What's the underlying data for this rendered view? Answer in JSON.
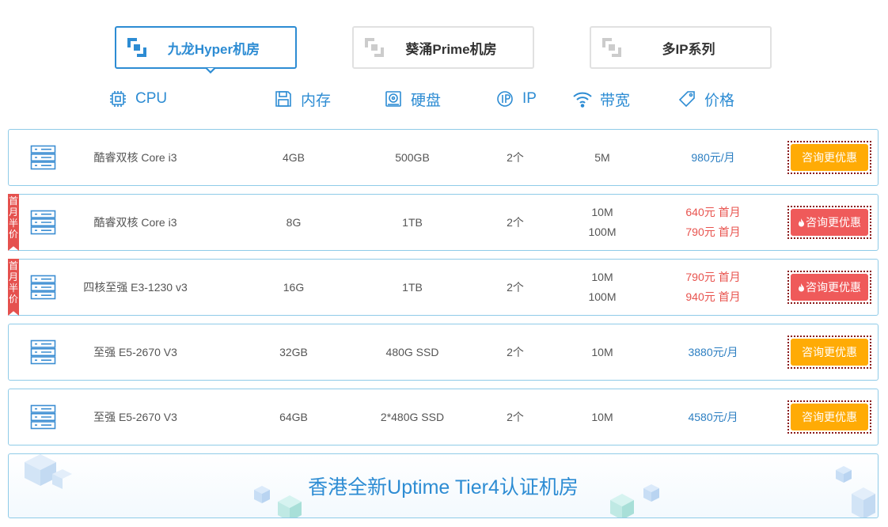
{
  "tabs": [
    {
      "label": "九龙Hyper机房",
      "active": true
    },
    {
      "label": "葵涌Prime机房",
      "active": false
    },
    {
      "label": "多IP系列",
      "active": false
    }
  ],
  "header": {
    "cpu": "CPU",
    "ram": "内存",
    "disk": "硬盘",
    "ip": "IP",
    "bandwidth": "带宽",
    "price": "价格"
  },
  "rows": [
    {
      "cpu": "酷睿双核 Core i3",
      "ram": "4GB",
      "disk": "500GB",
      "ip": "2个",
      "bw1": "5M",
      "bw2": "",
      "price1": "980元/月",
      "price2": "",
      "ribbon": "",
      "button": "咨询更优惠"
    },
    {
      "cpu": "酷睿双核 Core i3",
      "ram": "8G",
      "disk": "1TB",
      "ip": "2个",
      "bw1": "10M",
      "bw2": "100M",
      "price1": "640元 首月",
      "price2": "790元 首月",
      "ribbon": "首月半价",
      "button": "咨询更优惠"
    },
    {
      "cpu": "四核至强 E3-1230 v3",
      "ram": "16G",
      "disk": "1TB",
      "ip": "2个",
      "bw1": "10M",
      "bw2": "100M",
      "price1": "790元 首月",
      "price2": "940元 首月",
      "ribbon": "首月半价",
      "button": "咨询更优惠"
    },
    {
      "cpu": "至强 E5-2670 V3",
      "ram": "32GB",
      "disk": "480G SSD",
      "ip": "2个",
      "bw1": "10M",
      "bw2": "",
      "price1": "3880元/月",
      "price2": "",
      "ribbon": "",
      "button": "咨询更优惠"
    },
    {
      "cpu": "至强 E5-2670 V3",
      "ram": "64GB",
      "disk": "2*480G SSD",
      "ip": "2个",
      "bw1": "10M",
      "bw2": "",
      "price1": "4580元/月",
      "price2": "",
      "ribbon": "",
      "button": "咨询更优惠"
    }
  ],
  "ribbon_chars": [
    "首",
    "月",
    "半",
    "价"
  ],
  "banner": {
    "title": "香港全新Uptime Tier4认证机房"
  },
  "colors": {
    "accent": "#2d8cd3",
    "orange": "#ffab05",
    "red": "#ef5a5a",
    "price_blue": "#2d7fc2",
    "price_red": "#e8534e"
  },
  "icons": {
    "tab": "box-logo-icon",
    "cpu": "chip-icon",
    "ram": "memory-icon",
    "disk": "disk-icon",
    "ip": "ip-icon",
    "bandwidth": "wifi-icon",
    "price": "tag-icon",
    "row": "server-icon",
    "hot": "fire-icon"
  }
}
